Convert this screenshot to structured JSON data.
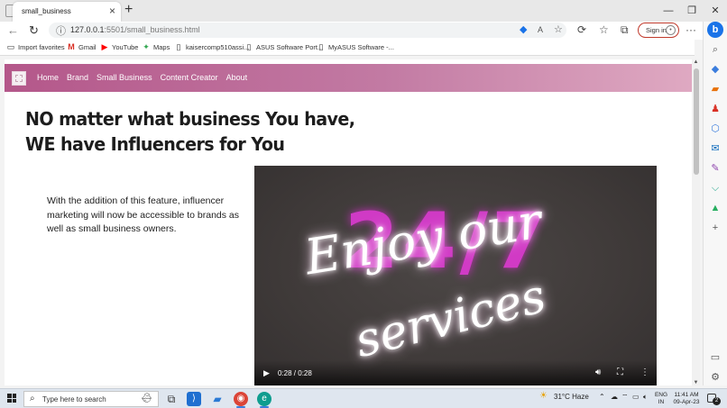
{
  "browser": {
    "tab_title": "small_business",
    "url_host": "127.0.0.1",
    "url_rest": ":5501/small_business.html",
    "signin_label": "Sign in",
    "favorites": [
      "Import favorites",
      "Gmail",
      "YouTube",
      "Maps",
      "kaisercomp510assi...",
      "ASUS Software Port...",
      "MyASUS Software -..."
    ]
  },
  "page": {
    "nav": [
      "Home",
      "Brand",
      "Small Business",
      "Content Creator",
      "About"
    ],
    "headline_line1": "NO matter what business You have,",
    "headline_line2": "WE have Influencers for You",
    "paragraph": "With the addition of this feature, influencer marketing will now be accessible to brands as well as small business owners.",
    "video": {
      "neon_digits": "24/7",
      "neon_line1": "Enjoy our",
      "neon_line2": "services",
      "time": "0:28 / 0:28"
    }
  },
  "taskbar": {
    "search_placeholder": "Type here to search",
    "weather": "31°C  Haze",
    "lang_line1": "ENG",
    "lang_line2": "IN",
    "time": "11:41 AM",
    "date": "09-Apr-23"
  },
  "colors": {
    "nav_gradient_start": "#b4578a",
    "nav_gradient_end": "#dfa9c2",
    "neon_pink": "#e03ad4"
  }
}
